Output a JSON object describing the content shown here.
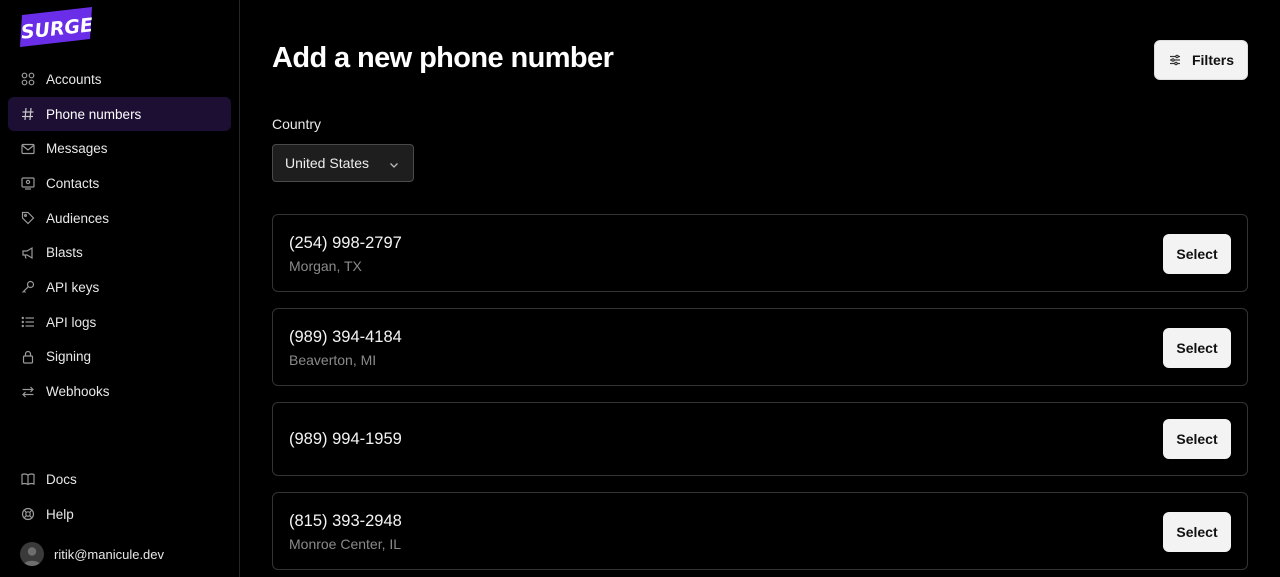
{
  "app": {
    "logo_text": "SURGE",
    "brand_color": "#6a2ee8"
  },
  "sidebar": {
    "items": [
      {
        "label": "Accounts",
        "icon": "accounts-icon",
        "active": false
      },
      {
        "label": "Phone numbers",
        "icon": "hash-icon",
        "active": true
      },
      {
        "label": "Messages",
        "icon": "envelope-icon",
        "active": false
      },
      {
        "label": "Contacts",
        "icon": "contact-card-icon",
        "active": false
      },
      {
        "label": "Audiences",
        "icon": "tag-icon",
        "active": false
      },
      {
        "label": "Blasts",
        "icon": "megaphone-icon",
        "active": false
      },
      {
        "label": "API keys",
        "icon": "key-icon",
        "active": false
      },
      {
        "label": "API logs",
        "icon": "list-icon",
        "active": false
      },
      {
        "label": "Signing",
        "icon": "lock-icon",
        "active": false
      },
      {
        "label": "Webhooks",
        "icon": "arrows-exchange-icon",
        "active": false
      }
    ],
    "bottom_items": [
      {
        "label": "Docs",
        "icon": "book-icon"
      },
      {
        "label": "Help",
        "icon": "help-icon"
      }
    ],
    "user": {
      "email": "ritik@manicule.dev"
    }
  },
  "main": {
    "title": "Add a new phone number",
    "filters_label": "Filters",
    "country_label": "Country",
    "country_value": "United States",
    "select_label": "Select",
    "numbers": [
      {
        "phone": "(254) 998-2797",
        "location": "Morgan, TX"
      },
      {
        "phone": "(989) 394-4184",
        "location": "Beaverton, MI"
      },
      {
        "phone": "(989) 994-1959",
        "location": ""
      },
      {
        "phone": "(815) 393-2948",
        "location": "Monroe Center, IL"
      }
    ]
  }
}
